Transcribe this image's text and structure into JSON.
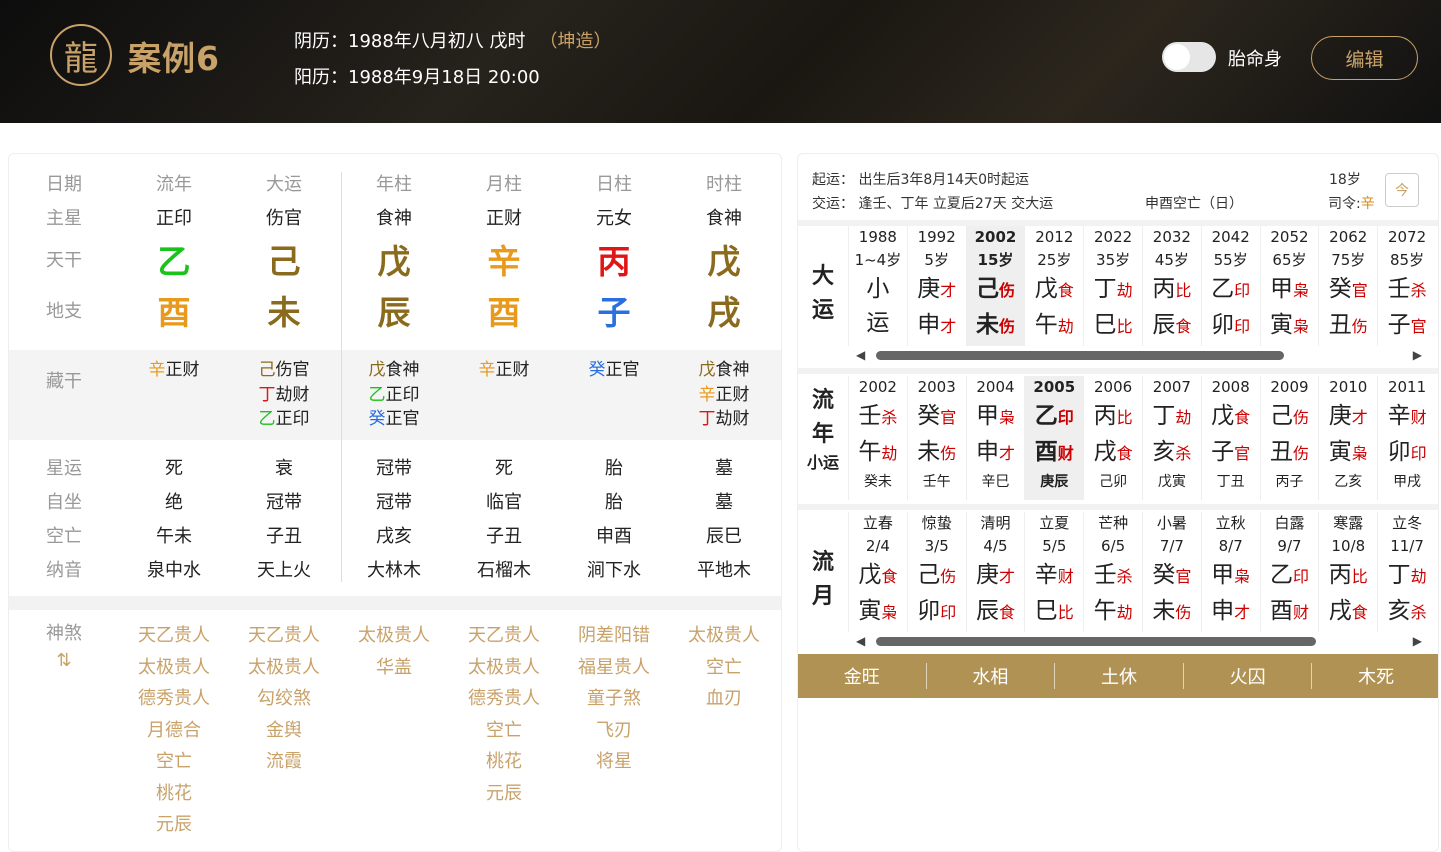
{
  "header": {
    "title": "案例6",
    "lunar": "阴历：1988年八月初八 戊时",
    "gender": "（坤造）",
    "solar": "阳历：1988年9月18日 20:00",
    "toggle_label": "胎命身",
    "edit_label": "编辑"
  },
  "left": {
    "headers": [
      "日期",
      "流年",
      "大运",
      "年柱",
      "月柱",
      "日柱",
      "时柱"
    ],
    "labels": {
      "zhuxing": "主星",
      "tiangan": "天干",
      "dizhi": "地支",
      "canggan": "藏干",
      "xingyun": "星运",
      "zizuo": "自坐",
      "kongwang": "空亡",
      "nayin": "纳音",
      "shensha": "神煞",
      "sort": "⇅"
    },
    "zhuxing": [
      "正印",
      "伤官",
      "食神",
      "正财",
      "元女",
      "食神"
    ],
    "tiangan": [
      {
        "char": "乙",
        "color": "#19c319"
      },
      {
        "char": "己",
        "color": "#8a6a1c"
      },
      {
        "char": "戊",
        "color": "#8a6a1c"
      },
      {
        "char": "辛",
        "color": "#e89a1c"
      },
      {
        "char": "丙",
        "color": "#e01515"
      },
      {
        "char": "戊",
        "color": "#8a6a1c"
      }
    ],
    "dizhi": [
      {
        "char": "酉",
        "color": "#e89a1c"
      },
      {
        "char": "未",
        "color": "#8a6a1c"
      },
      {
        "char": "辰",
        "color": "#8a6a1c"
      },
      {
        "char": "酉",
        "color": "#e89a1c"
      },
      {
        "char": "子",
        "color": "#2a6fe0"
      },
      {
        "char": "戌",
        "color": "#8a6a1c"
      }
    ],
    "canggan": [
      [
        {
          "g": "辛",
          "c": "#e89a1c",
          "s": "正财"
        }
      ],
      [
        {
          "g": "己",
          "c": "#8a6a1c",
          "s": "伤官"
        },
        {
          "g": "丁",
          "c": "#e01515",
          "s": "劫财"
        },
        {
          "g": "乙",
          "c": "#19c319",
          "s": "正印"
        }
      ],
      [
        {
          "g": "戊",
          "c": "#8a6a1c",
          "s": "食神"
        },
        {
          "g": "乙",
          "c": "#19c319",
          "s": "正印"
        },
        {
          "g": "癸",
          "c": "#2a6fe0",
          "s": "正官"
        }
      ],
      [
        {
          "g": "辛",
          "c": "#e89a1c",
          "s": "正财"
        }
      ],
      [
        {
          "g": "癸",
          "c": "#2a6fe0",
          "s": "正官"
        }
      ],
      [
        {
          "g": "戊",
          "c": "#8a6a1c",
          "s": "食神"
        },
        {
          "g": "辛",
          "c": "#e89a1c",
          "s": "正财"
        },
        {
          "g": "丁",
          "c": "#e01515",
          "s": "劫财"
        }
      ]
    ],
    "xingyun": [
      "死",
      "衰",
      "冠带",
      "死",
      "胎",
      "墓"
    ],
    "zizuo": [
      "绝",
      "冠带",
      "冠带",
      "临官",
      "胎",
      "墓"
    ],
    "kongwang": [
      "午未",
      "子丑",
      "戌亥",
      "子丑",
      "申酉",
      "辰巳"
    ],
    "nayin": [
      "泉中水",
      "天上火",
      "大林木",
      "石榴木",
      "涧下水",
      "平地木"
    ],
    "shensha": [
      [
        "天乙贵人",
        "太极贵人",
        "德秀贵人",
        "月德合",
        "空亡",
        "桃花",
        "元辰"
      ],
      [
        "天乙贵人",
        "太极贵人",
        "勾绞煞",
        "金舆",
        "流霞"
      ],
      [
        "太极贵人",
        "华盖"
      ],
      [
        "天乙贵人",
        "太极贵人",
        "德秀贵人",
        "空亡",
        "桃花",
        "元辰"
      ],
      [
        "阴差阳错",
        "福星贵人",
        "童子煞",
        "飞刃",
        "将星"
      ],
      [
        "太极贵人",
        "空亡",
        "血刃"
      ]
    ]
  },
  "right": {
    "qiyun": "起运：  出生后3年8月14天0时起运",
    "jiaoyun": "交运：  逢壬、丁年 立夏后27天 交大运",
    "kong": "申酉空亡（日）",
    "age": "18岁",
    "siling": "司令:",
    "siling_val": "辛",
    "cal_icon": "今",
    "dayun_title": [
      "大",
      "运"
    ],
    "dayun": [
      {
        "y": "1988",
        "a": "1~4岁",
        "g": "小",
        "gs": "",
        "z": "运",
        "zs": ""
      },
      {
        "y": "1992",
        "a": "5岁",
        "g": "庚",
        "gs": "才",
        "z": "申",
        "zs": "才"
      },
      {
        "y": "2002",
        "a": "15岁",
        "g": "己",
        "gs": "伤",
        "z": "未",
        "zs": "伤",
        "sel": true
      },
      {
        "y": "2012",
        "a": "25岁",
        "g": "戊",
        "gs": "食",
        "z": "午",
        "zs": "劫"
      },
      {
        "y": "2022",
        "a": "35岁",
        "g": "丁",
        "gs": "劫",
        "z": "巳",
        "zs": "比"
      },
      {
        "y": "2032",
        "a": "45岁",
        "g": "丙",
        "gs": "比",
        "z": "辰",
        "zs": "食"
      },
      {
        "y": "2042",
        "a": "55岁",
        "g": "乙",
        "gs": "印",
        "z": "卯",
        "zs": "印"
      },
      {
        "y": "2052",
        "a": "65岁",
        "g": "甲",
        "gs": "枭",
        "z": "寅",
        "zs": "枭"
      },
      {
        "y": "2062",
        "a": "75岁",
        "g": "癸",
        "gs": "官",
        "z": "丑",
        "zs": "伤"
      },
      {
        "y": "2072",
        "a": "85岁",
        "g": "壬",
        "gs": "杀",
        "z": "子",
        "zs": "官"
      }
    ],
    "liunian_title": [
      "流",
      "年",
      "小运"
    ],
    "liunian": [
      {
        "y": "2002",
        "g": "壬",
        "gs": "杀",
        "z": "午",
        "zs": "劫",
        "x": "癸未"
      },
      {
        "y": "2003",
        "g": "癸",
        "gs": "官",
        "z": "未",
        "zs": "伤",
        "x": "壬午"
      },
      {
        "y": "2004",
        "g": "甲",
        "gs": "枭",
        "z": "申",
        "zs": "才",
        "x": "辛巳"
      },
      {
        "y": "2005",
        "g": "乙",
        "gs": "印",
        "z": "酉",
        "zs": "财",
        "x": "庚辰",
        "sel": true
      },
      {
        "y": "2006",
        "g": "丙",
        "gs": "比",
        "z": "戌",
        "zs": "食",
        "x": "己卯"
      },
      {
        "y": "2007",
        "g": "丁",
        "gs": "劫",
        "z": "亥",
        "zs": "杀",
        "x": "戊寅"
      },
      {
        "y": "2008",
        "g": "戊",
        "gs": "食",
        "z": "子",
        "zs": "官",
        "x": "丁丑"
      },
      {
        "y": "2009",
        "g": "己",
        "gs": "伤",
        "z": "丑",
        "zs": "伤",
        "x": "丙子"
      },
      {
        "y": "2010",
        "g": "庚",
        "gs": "才",
        "z": "寅",
        "zs": "枭",
        "x": "乙亥"
      },
      {
        "y": "2011",
        "g": "辛",
        "gs": "财",
        "z": "卯",
        "zs": "印",
        "x": "甲戌"
      }
    ],
    "liuyue_title": [
      "流",
      "月"
    ],
    "liuyue": [
      {
        "t": "立春",
        "d": "2/4",
        "g": "戊",
        "gs": "食",
        "z": "寅",
        "zs": "枭"
      },
      {
        "t": "惊蛰",
        "d": "3/5",
        "g": "己",
        "gs": "伤",
        "z": "卯",
        "zs": "印"
      },
      {
        "t": "清明",
        "d": "4/5",
        "g": "庚",
        "gs": "才",
        "z": "辰",
        "zs": "食"
      },
      {
        "t": "立夏",
        "d": "5/5",
        "g": "辛",
        "gs": "财",
        "z": "巳",
        "zs": "比"
      },
      {
        "t": "芒种",
        "d": "6/5",
        "g": "壬",
        "gs": "杀",
        "z": "午",
        "zs": "劫"
      },
      {
        "t": "小暑",
        "d": "7/7",
        "g": "癸",
        "gs": "官",
        "z": "未",
        "zs": "伤"
      },
      {
        "t": "立秋",
        "d": "8/7",
        "g": "甲",
        "gs": "枭",
        "z": "申",
        "zs": "才"
      },
      {
        "t": "白露",
        "d": "9/7",
        "g": "乙",
        "gs": "印",
        "z": "酉",
        "zs": "财"
      },
      {
        "t": "寒露",
        "d": "10/8",
        "g": "丙",
        "gs": "比",
        "z": "戌",
        "zs": "食"
      },
      {
        "t": "立冬",
        "d": "11/7",
        "g": "丁",
        "gs": "劫",
        "z": "亥",
        "zs": "杀"
      }
    ],
    "wuxing": [
      "金旺",
      "水相",
      "土休",
      "火囚",
      "木死"
    ]
  }
}
